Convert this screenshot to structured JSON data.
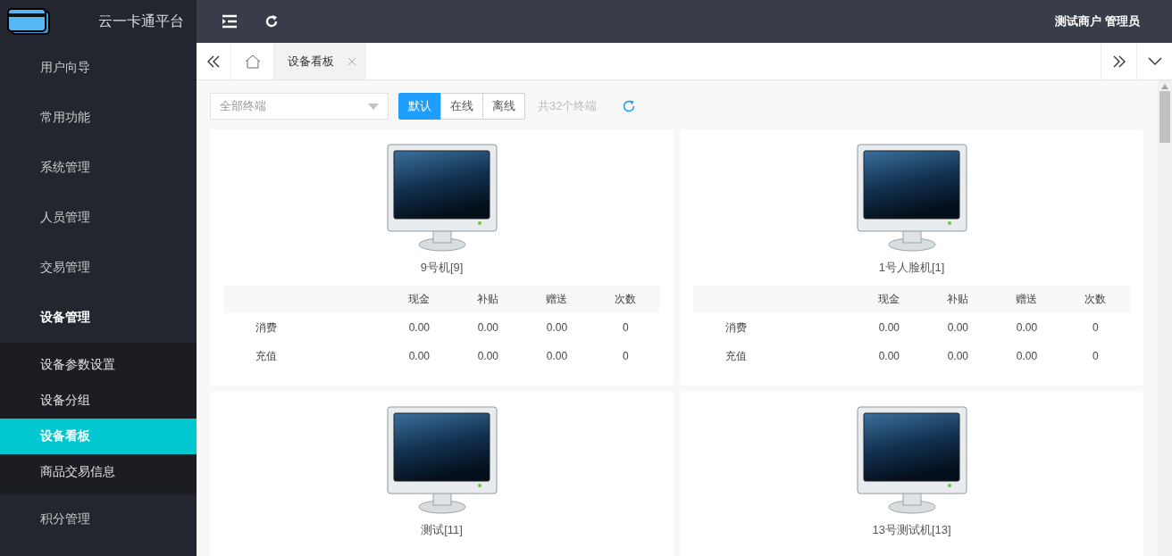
{
  "app": {
    "title": "云一卡通平台"
  },
  "topbar": {
    "user": "测试商户 管理员"
  },
  "sidebar": {
    "items": [
      {
        "label": "用户向导",
        "expanded": false
      },
      {
        "label": "常用功能",
        "expanded": false
      },
      {
        "label": "系统管理",
        "expanded": false
      },
      {
        "label": "人员管理",
        "expanded": false
      },
      {
        "label": "交易管理",
        "expanded": false
      },
      {
        "label": "设备管理",
        "expanded": true,
        "children": [
          {
            "label": "设备参数设置",
            "selected": false
          },
          {
            "label": "设备分组",
            "selected": false
          },
          {
            "label": "设备看板",
            "selected": true
          },
          {
            "label": "商品交易信息",
            "selected": false
          }
        ]
      },
      {
        "label": "积分管理",
        "expanded": false
      }
    ]
  },
  "tabs": [
    {
      "label": "设备看板",
      "selected": true
    }
  ],
  "filter": {
    "placeholder": "全部终端"
  },
  "status_buttons": [
    {
      "label": "默认",
      "selected": true
    },
    {
      "label": "在线",
      "selected": false
    },
    {
      "label": "离线",
      "selected": false
    }
  ],
  "count": "共32个终端",
  "devices": [
    {
      "name": "9号机[9]",
      "table": {
        "columns": [
          "现金",
          "补贴",
          "赠送",
          "次数"
        ],
        "rows": [
          {
            "label": "消费",
            "values": [
              "0.00",
              "0.00",
              "0.00",
              "0"
            ]
          },
          {
            "label": "充值",
            "values": [
              "0.00",
              "0.00",
              "0.00",
              "0"
            ]
          }
        ]
      }
    },
    {
      "name": "1号人脸机[1]",
      "table": {
        "columns": [
          "现金",
          "补贴",
          "赠送",
          "次数"
        ],
        "rows": [
          {
            "label": "消费",
            "values": [
              "0.00",
              "0.00",
              "0.00",
              "0"
            ]
          },
          {
            "label": "充值",
            "values": [
              "0.00",
              "0.00",
              "0.00",
              "0"
            ]
          }
        ]
      }
    },
    {
      "name": "测试[11]"
    },
    {
      "name": "13号测试机[13]"
    }
  ]
}
